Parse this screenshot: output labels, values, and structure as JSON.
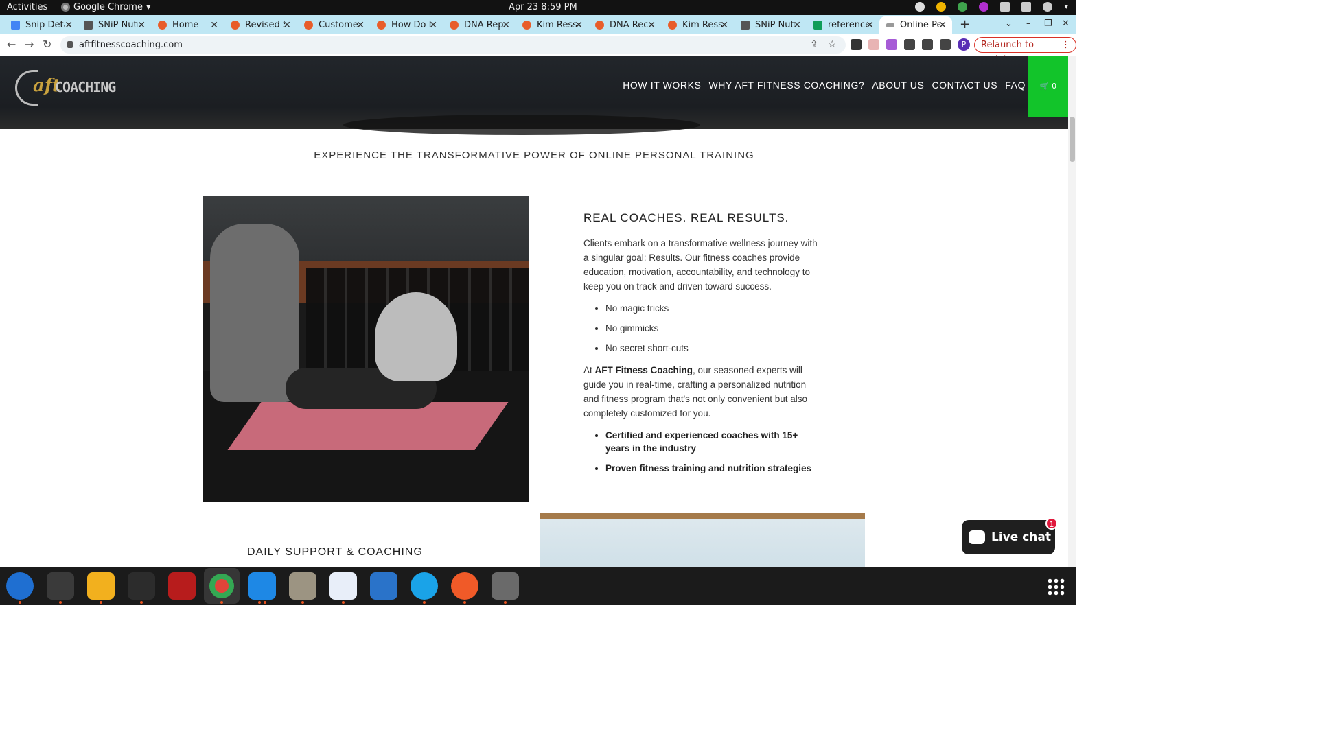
{
  "topbar": {
    "activities": "Activities",
    "app_name": "Google Chrome",
    "clock": "Apr 23  8:59 PM"
  },
  "tabs": [
    {
      "title": "Snip Deta",
      "icon": "docs-icon",
      "color": "#4285f4"
    },
    {
      "title": "SNiP Nutr",
      "icon": "snip-icon",
      "color": "#555555"
    },
    {
      "title": "Home",
      "icon": "site-icon",
      "color": "#e85d2a"
    },
    {
      "title": "Revised S",
      "icon": "site-icon",
      "color": "#e85d2a"
    },
    {
      "title": "Customer",
      "icon": "site-icon",
      "color": "#e85d2a"
    },
    {
      "title": "How Do D",
      "icon": "site-icon",
      "color": "#e85d2a"
    },
    {
      "title": "DNA Rep",
      "icon": "site-icon",
      "color": "#e85d2a"
    },
    {
      "title": "Kim Ress",
      "icon": "site-icon",
      "color": "#e85d2a"
    },
    {
      "title": "DNA Rec",
      "icon": "site-icon",
      "color": "#e85d2a"
    },
    {
      "title": "Kim Ress",
      "icon": "site-icon",
      "color": "#e85d2a"
    },
    {
      "title": "SNiP Nutr",
      "icon": "snip-icon",
      "color": "#555555"
    },
    {
      "title": "reference",
      "icon": "sheets-icon",
      "color": "#0f9d58"
    },
    {
      "title": "Online Pe",
      "icon": "site-icon",
      "color": "#999999",
      "active": true
    }
  ],
  "browser": {
    "url": "aftfitnesscoaching.com",
    "relaunch_label": "Relaunch to update",
    "profile_initial": "P"
  },
  "site": {
    "logo_aft": "aft",
    "logo_coaching": "COACHING",
    "nav": [
      "HOW IT WORKS",
      "WHY AFT FITNESS COACHING?",
      "ABOUT US",
      "CONTACT US",
      "FAQ"
    ],
    "cart_count": "0",
    "tagline": "EXPERIENCE THE TRANSFORMATIVE POWER OF ONLINE PERSONAL TRAINING",
    "section_heading": "REAL COACHES. REAL RESULTS.",
    "intro": "Clients embark on a transformative wellness journey with a singular goal: Results. Our fitness coaches provide education, motivation, accountability, and technology to keep you on track and driven toward success.",
    "bullets": [
      "No magic tricks",
      "No gimmicks",
      "No secret short-cuts"
    ],
    "para2_prefix": "At ",
    "para2_bold": "AFT Fitness Coaching",
    "para2_suffix": ", our seasoned experts will guide you in real-time, crafting a personalized nutrition and fitness program that's not only convenient but also completely customized for you.",
    "bold_bullets": [
      "Certified and experienced coaches with 15+ years in the industry",
      "Proven fitness training and nutrition strategies"
    ],
    "next_heading": "DAILY SUPPORT & COACHING"
  },
  "livechat": {
    "label": "Live chat",
    "badge": "1"
  },
  "colors": {
    "cart_green": "#12c42a",
    "tab_strip": "#bfe7f4",
    "relaunch_red": "#b3261e"
  }
}
